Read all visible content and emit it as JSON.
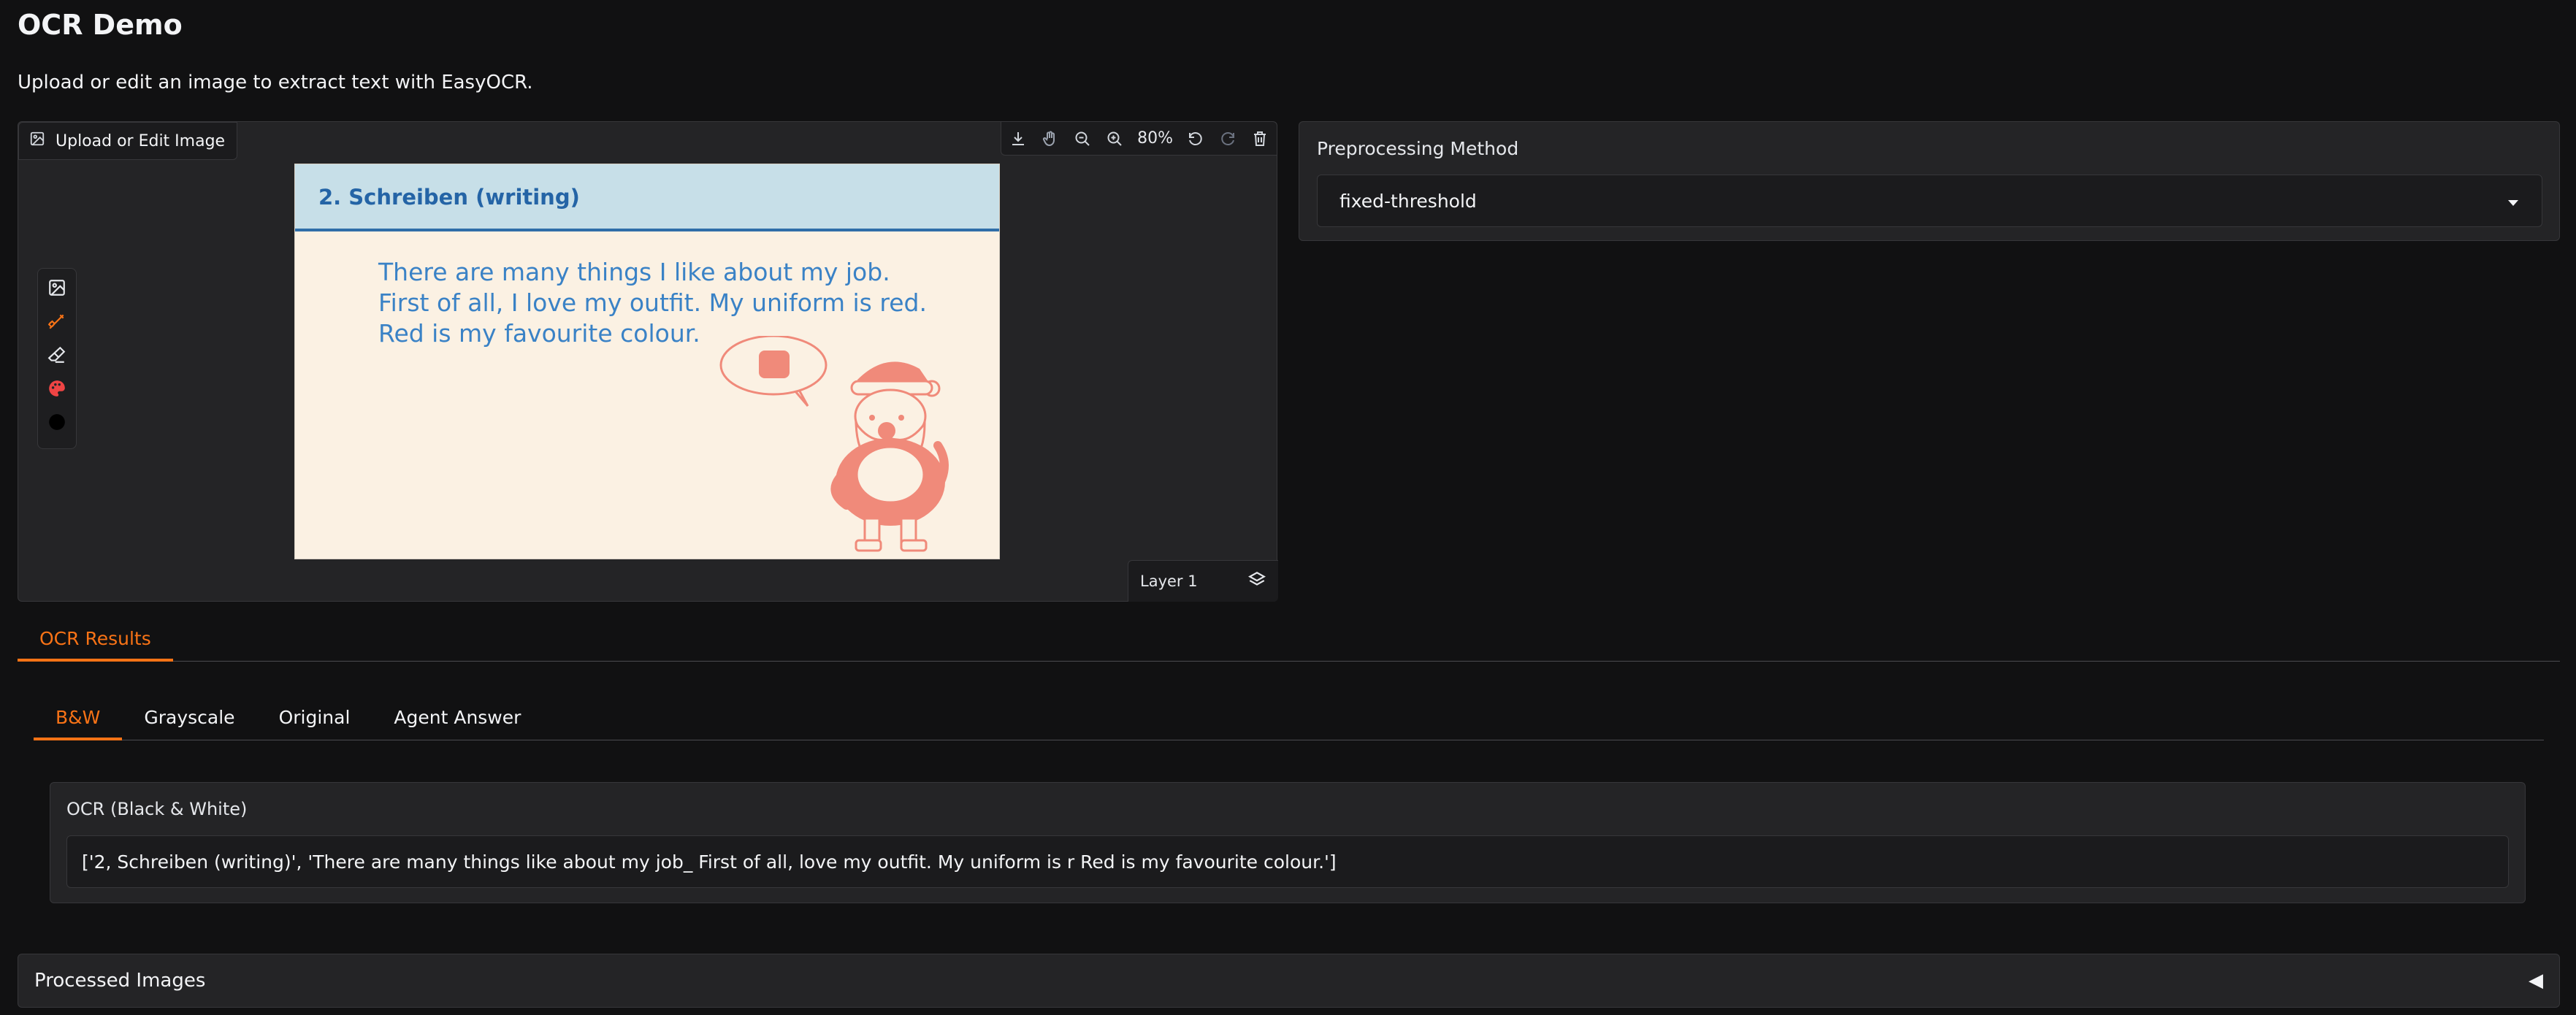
{
  "page": {
    "title": "OCR Demo",
    "description": "Upload or edit an image to extract text with EasyOCR."
  },
  "editor": {
    "label": "Upload or Edit Image",
    "zoom": "80%",
    "layer_label": "Layer 1",
    "toolbar_icons": [
      "download-icon",
      "pan-hand-icon",
      "zoom-out-icon",
      "zoom-in-icon",
      "undo-icon",
      "redo-icon",
      "trash-icon"
    ],
    "side_tools": [
      "image-icon",
      "brush-icon",
      "eraser-icon",
      "palette-icon",
      "color-swatch-icon"
    ],
    "brush_color": "#f97316",
    "swatch_color": "#000000",
    "canvas": {
      "heading": "2. Schreiben (writing)",
      "lines": [
        "There are many things I like about my job.",
        "First of all, I love my outfit. My uniform is red.",
        "Red is my favourite colour."
      ]
    }
  },
  "preprocessing": {
    "label": "Preprocessing Method",
    "selected": "fixed-threshold"
  },
  "results_tabs": [
    {
      "label": "OCR Results",
      "active": true
    }
  ],
  "sub_tabs": [
    {
      "label": "B&W",
      "active": true
    },
    {
      "label": "Grayscale",
      "active": false
    },
    {
      "label": "Original",
      "active": false
    },
    {
      "label": "Agent Answer",
      "active": false
    }
  ],
  "ocr": {
    "label": "OCR (Black & White)",
    "value": "['2, Schreiben (writing)', 'There are many things like about my job_ First of all, love my outfit. My uniform is r Red is my favourite colour.']"
  },
  "processed_images": {
    "label": "Processed Images",
    "arrow": "◀"
  },
  "colors": {
    "accent": "#f97316",
    "background": "#111112",
    "panel": "#242426"
  }
}
